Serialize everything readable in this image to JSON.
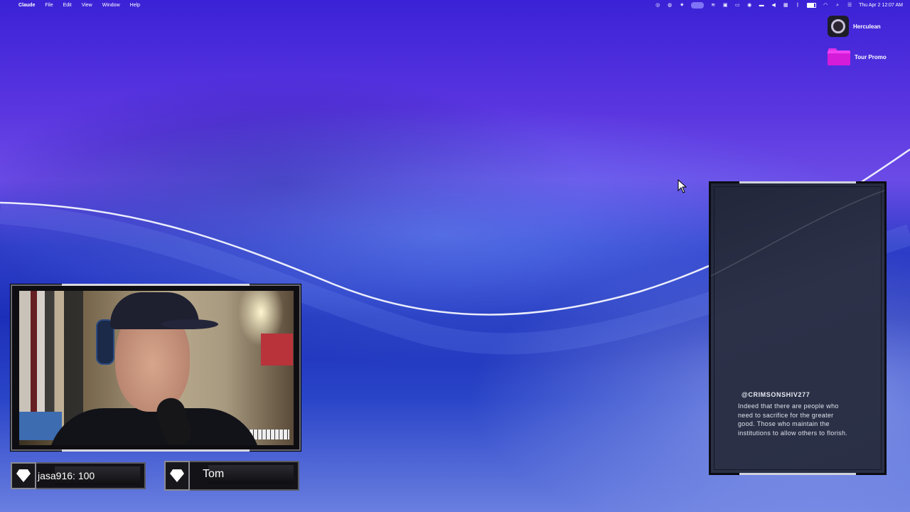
{
  "menubar": {
    "app_name": "Claude",
    "menus": [
      "File",
      "Edit",
      "View",
      "Window",
      "Help"
    ],
    "status_icons": [
      "screen-record-icon",
      "activity-icon",
      "sun-icon",
      "display-icon",
      "waveform-icon",
      "calendar-icon",
      "screen-mirror-icon",
      "play-icon",
      "car-icon",
      "volume-icon",
      "shield-icon",
      "bluetooth-icon",
      "battery-icon",
      "wifi-icon",
      "search-icon",
      "control-center-icon"
    ],
    "datetime": "Thu Apr 2  12:07 AM"
  },
  "desktop": {
    "icons": [
      {
        "label": "Herculean",
        "icon": "album-art-icon"
      },
      {
        "label": "Tour Promo",
        "icon": "folder-icon",
        "color": "#d51cd9"
      }
    ]
  },
  "overlay": {
    "donor_plate": {
      "text": "jasa916: 100",
      "icon": "diamond-icon"
    },
    "name_plate": {
      "text": "Tom",
      "icon": "diamond-icon"
    },
    "chat": {
      "username": "@CRIMSONSHIV277",
      "message": "Indeed that there are people who need to sacrifice for the greater good. Those who maintain the institutions to allow others to florish."
    }
  },
  "colors": {
    "wallpaper_primary": "#3b22d6",
    "folder": "#d51cd9",
    "menubar_highlight": "#7f74f5"
  }
}
